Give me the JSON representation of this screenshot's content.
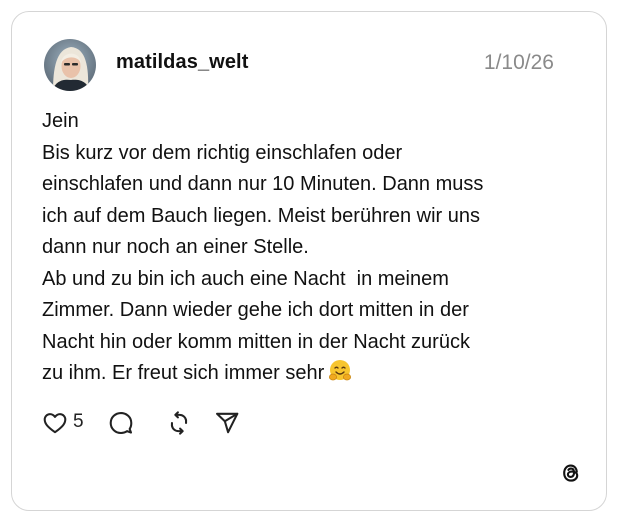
{
  "post": {
    "username": "matildas_welt",
    "date": "1/10/26",
    "lines": [
      "Jein",
      "Bis kurz vor dem richtig einschlafen oder",
      "einschlafen und dann nur 10 Minuten. Dann muss",
      "ich auf dem Bauch liegen. Meist berühren wir uns",
      "dann nur noch an einer Stelle.",
      "Ab und zu bin ich auch eine Nacht  in meinem",
      "Zimmer. Dann wieder gehe ich dort mitten in der",
      "Nacht hin oder komm mitten in der Nacht zurück",
      "zu ihm. Er freut sich immer sehr"
    ],
    "emoji": "hugging-face-emoji",
    "likes": "5"
  },
  "icons": {
    "like": "heart-icon",
    "reply": "comment-bubble-icon",
    "repost": "repost-icon",
    "share": "send-icon",
    "brand": "threads-logo-icon"
  },
  "colors": {
    "text": "#111111",
    "date": "#8a8a8a",
    "border": "#d5d5d5",
    "emoji": "#f7c52e"
  }
}
